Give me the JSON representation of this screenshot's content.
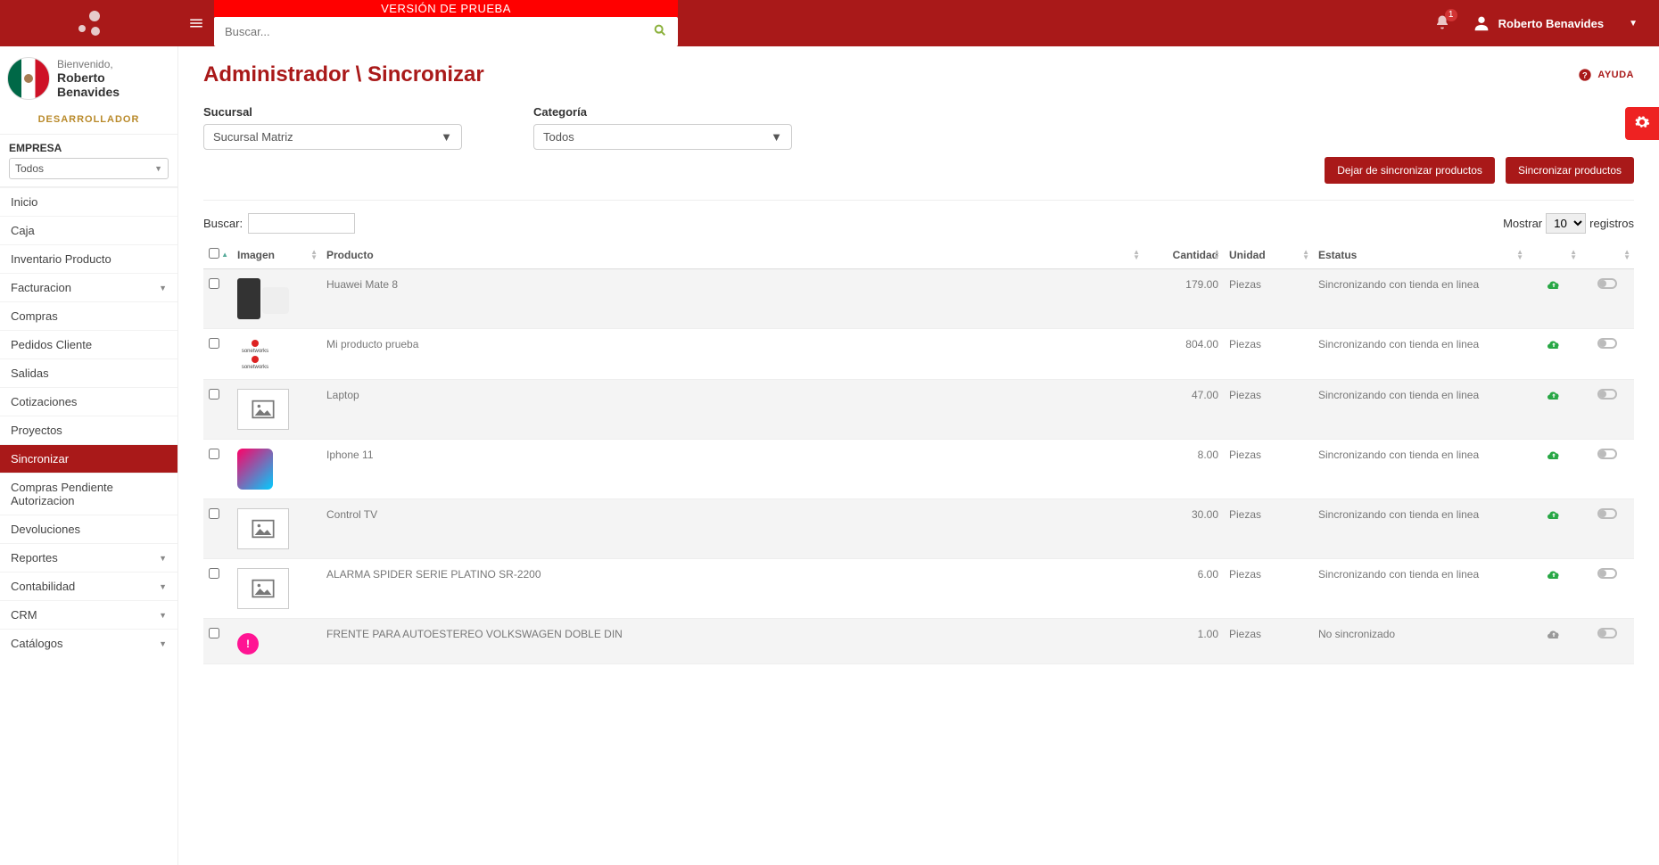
{
  "topbar": {
    "trial_text": "VERSIÓN DE PRUEBA",
    "search_placeholder": "Buscar...",
    "notification_count": "1",
    "user_name": "Roberto Benavides"
  },
  "sidebar": {
    "welcome": "Bienvenido,",
    "user_first": "Roberto",
    "user_last": "Benavides",
    "role": "DESARROLLADOR",
    "empresa_label": "EMPRESA",
    "empresa_value": "Todos",
    "items": [
      {
        "label": "Inicio",
        "expandable": false,
        "active": false
      },
      {
        "label": "Caja",
        "expandable": false,
        "active": false
      },
      {
        "label": "Inventario Producto",
        "expandable": false,
        "active": false
      },
      {
        "label": "Facturacion",
        "expandable": true,
        "active": false
      },
      {
        "label": "Compras",
        "expandable": false,
        "active": false
      },
      {
        "label": "Pedidos Cliente",
        "expandable": false,
        "active": false
      },
      {
        "label": "Salidas",
        "expandable": false,
        "active": false
      },
      {
        "label": "Cotizaciones",
        "expandable": false,
        "active": false
      },
      {
        "label": "Proyectos",
        "expandable": false,
        "active": false
      },
      {
        "label": "Sincronizar",
        "expandable": false,
        "active": true
      },
      {
        "label": "Compras Pendiente Autorizacion",
        "expandable": false,
        "active": false
      },
      {
        "label": "Devoluciones",
        "expandable": false,
        "active": false
      },
      {
        "label": "Reportes",
        "expandable": true,
        "active": false
      },
      {
        "label": "Contabilidad",
        "expandable": true,
        "active": false
      },
      {
        "label": "CRM",
        "expandable": true,
        "active": false
      },
      {
        "label": "Catálogos",
        "expandable": true,
        "active": false
      }
    ]
  },
  "main": {
    "title": "Administrador \\ Sincronizar",
    "help_label": "AYUDA",
    "filters": {
      "sucursal_label": "Sucursal",
      "sucursal_value": "Sucursal Matriz",
      "categoria_label": "Categoría",
      "categoria_value": "Todos"
    },
    "buttons": {
      "stop_sync": "Dejar de sincronizar productos",
      "sync": "Sincronizar productos"
    },
    "table": {
      "search_label": "Buscar:",
      "show_label": "Mostrar",
      "show_value": "10",
      "show_suffix": "registros",
      "headers": {
        "imagen": "Imagen",
        "producto": "Producto",
        "cantidad": "Cantidad",
        "unidad": "Unidad",
        "estatus": "Estatus"
      },
      "rows": [
        {
          "producto": "Huawei Mate 8",
          "cantidad": "179.00",
          "unidad": "Piezas",
          "estatus": "Sincronizando con tienda en linea",
          "synced": true,
          "thumb": "phone"
        },
        {
          "producto": "Mi producto prueba",
          "cantidad": "804.00",
          "unidad": "Piezas",
          "estatus": "Sincronizando con tienda en linea",
          "synced": true,
          "thumb": "logo"
        },
        {
          "producto": "Laptop",
          "cantidad": "47.00",
          "unidad": "Piezas",
          "estatus": "Sincronizando con tienda en linea",
          "synced": true,
          "thumb": "ph"
        },
        {
          "producto": "Iphone 11",
          "cantidad": "8.00",
          "unidad": "Piezas",
          "estatus": "Sincronizando con tienda en linea",
          "synced": true,
          "thumb": "colorful"
        },
        {
          "producto": "Control TV",
          "cantidad": "30.00",
          "unidad": "Piezas",
          "estatus": "Sincronizando con tienda en linea",
          "synced": true,
          "thumb": "ph"
        },
        {
          "producto": "ALARMA SPIDER SERIE PLATINO SR-2200",
          "cantidad": "6.00",
          "unidad": "Piezas",
          "estatus": "Sincronizando con tienda en linea",
          "synced": true,
          "thumb": "ph"
        },
        {
          "producto": "FRENTE PARA AUTOESTEREO VOLKSWAGEN DOBLE DIN",
          "cantidad": "1.00",
          "unidad": "Piezas",
          "estatus": "No sincronizado",
          "synced": false,
          "thumb": "badge"
        }
      ]
    }
  }
}
